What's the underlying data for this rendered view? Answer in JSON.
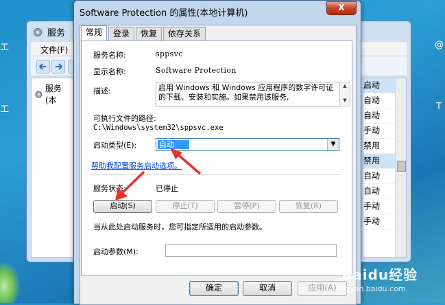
{
  "desktop": {
    "chars": [
      "工",
      "工",
      "@",
      "T"
    ]
  },
  "services_window": {
    "title": "服务",
    "menu_file": "文件(F)",
    "tree_node": "服务(本",
    "status_rows": [
      "启动",
      "自动",
      "自动",
      "手动",
      "禁用",
      "禁用",
      "自动",
      "自动",
      "手动",
      "手动"
    ]
  },
  "dialog": {
    "title": "Software Protection 的属性(本地计算机)",
    "close_label": "X",
    "tabs": [
      "常规",
      "登录",
      "恢复",
      "依存关系"
    ],
    "service_name_label": "服务名称:",
    "service_name_value": "sppsvc",
    "display_name_label": "显示名称:",
    "display_name_value": "Software Protection",
    "description_label": "描述:",
    "description_value": "启用 Windows 和 Windows 应用程序的数字许可证的下载、安装和实施。如果禁用该服务,",
    "exe_path_label": "可执行文件的路径:",
    "exe_path_value": "C:\\Windows\\system32\\sppsvc.exe",
    "startup_type_label": "启动类型(E):",
    "startup_type_value": "自动",
    "help_link": "帮助我配置服务启动选项。",
    "service_status_label": "服务状态:",
    "service_status_value": "已停止",
    "btn_start": "启动(S)",
    "btn_stop": "停止(T)",
    "btn_pause": "暂停(P)",
    "btn_resume": "恢复(R)",
    "hint": "当从此处启动服务时，您可指定所适用的启动参数。",
    "start_params_label": "启动参数(M):",
    "start_params_value": "",
    "ok": "确定",
    "cancel": "取消",
    "apply": "应用(A)"
  },
  "watermark": {
    "main": "Baidu经验",
    "sub": "jingyan.baidu.com"
  },
  "colors": {
    "accent": "#3399ff",
    "arrow": "#e8322a",
    "link": "#0046d5"
  }
}
